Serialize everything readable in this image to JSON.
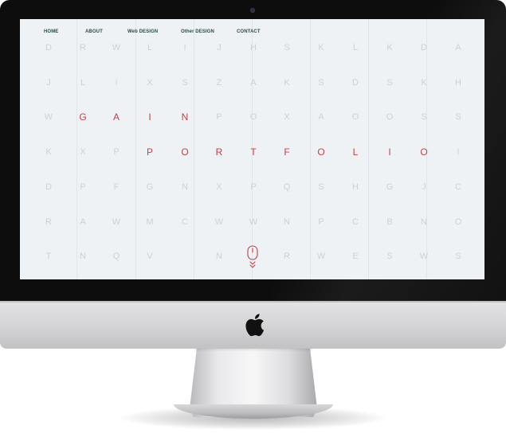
{
  "nav": {
    "items": [
      {
        "label": "HOME"
      },
      {
        "label": "ABOUT"
      },
      {
        "label": "Web DESIGN"
      },
      {
        "label": "Other DESIGN"
      },
      {
        "label": "CONTACT"
      }
    ]
  },
  "grid": {
    "rows": [
      [
        "D",
        "R",
        "W",
        "L",
        "I",
        "J",
        "H",
        "S",
        "K",
        "L",
        "K",
        "D",
        "A"
      ],
      [
        "J",
        "L",
        "I",
        "X",
        "S",
        "Z",
        "A",
        "K",
        "S",
        "D",
        "S",
        "K",
        "H"
      ],
      [
        "W",
        "G",
        "A",
        "I",
        "N",
        "P",
        "O",
        "X",
        "A",
        "O",
        "O",
        "S",
        "S"
      ],
      [
        "K",
        "X",
        "P",
        "P",
        "O",
        "R",
        "T",
        "F",
        "O",
        "L",
        "I",
        "O",
        "I"
      ],
      [
        "D",
        "P",
        "F",
        "G",
        "N",
        "X",
        "P",
        "Q",
        "S",
        "H",
        "G",
        "J",
        "C"
      ],
      [
        "R",
        "A",
        "W",
        "M",
        "C",
        "W",
        "W",
        "N",
        "P",
        "C",
        "B",
        "N",
        "O"
      ],
      [
        "T",
        "N",
        "Q",
        "V",
        "",
        "N",
        "",
        "R",
        "W",
        "E",
        "S",
        "W",
        "S"
      ]
    ],
    "highlight": [
      {
        "row": 2,
        "cols": [
          1,
          2,
          3,
          4
        ]
      },
      {
        "row": 3,
        "cols": [
          3,
          4,
          5,
          6,
          7,
          8,
          9,
          10,
          11
        ]
      }
    ]
  },
  "colors": {
    "screen_bg": "#eef2f5",
    "letter": "#c9d1d8",
    "accent": "#c43f46",
    "nav": "#2e4a4d"
  },
  "icons": {
    "scroll": "mouse-scroll-icon",
    "brand": "apple-logo-icon",
    "camera": "webcam-icon"
  }
}
